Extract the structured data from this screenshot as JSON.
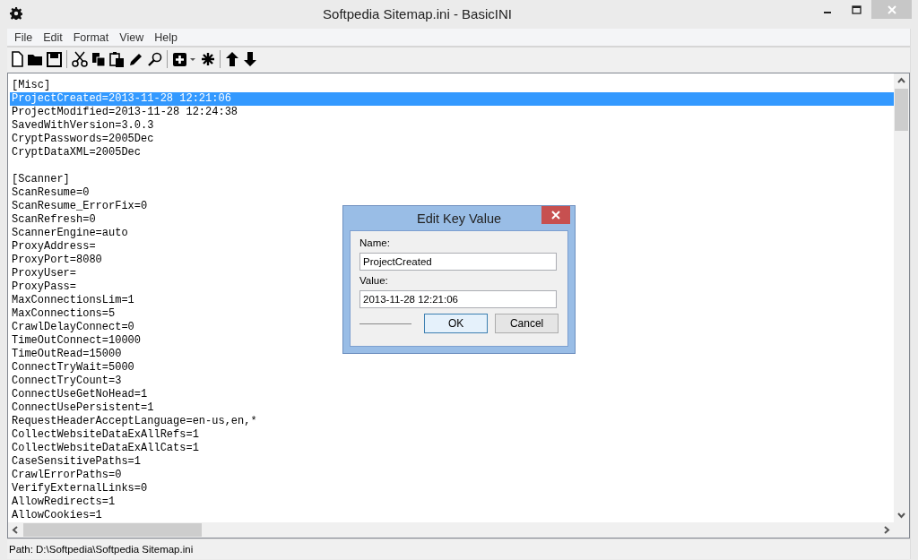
{
  "window": {
    "title": "Softpedia Sitemap.ini - BasicINI"
  },
  "menu": [
    "File",
    "Edit",
    "Format",
    "View",
    "Help"
  ],
  "sections": [
    {
      "lines": [
        {
          "text": "[Misc]",
          "selected": false
        },
        {
          "text": "ProjectCreated=2013-11-28 12:21:06",
          "selected": true
        },
        {
          "text": "ProjectModified=2013-11-28 12:24:38",
          "selected": false
        },
        {
          "text": "SavedWithVersion=3.0.3",
          "selected": false
        },
        {
          "text": "CryptPasswords=2005Dec",
          "selected": false
        },
        {
          "text": "CryptDataXML=2005Dec",
          "selected": false
        }
      ]
    },
    {
      "lines": [
        {
          "text": "[Scanner]",
          "selected": false
        },
        {
          "text": "ScanResume=0",
          "selected": false
        },
        {
          "text": "ScanResume_ErrorFix=0",
          "selected": false
        },
        {
          "text": "ScanRefresh=0",
          "selected": false
        },
        {
          "text": "ScannerEngine=auto",
          "selected": false
        },
        {
          "text": "ProxyAddress=",
          "selected": false
        },
        {
          "text": "ProxyPort=8080",
          "selected": false
        },
        {
          "text": "ProxyUser=",
          "selected": false
        },
        {
          "text": "ProxyPass=",
          "selected": false
        },
        {
          "text": "MaxConnectionsLim=1",
          "selected": false
        },
        {
          "text": "MaxConnections=5",
          "selected": false
        },
        {
          "text": "CrawlDelayConnect=0",
          "selected": false
        },
        {
          "text": "TimeOutConnect=10000",
          "selected": false
        },
        {
          "text": "TimeOutRead=15000",
          "selected": false
        },
        {
          "text": "ConnectTryWait=5000",
          "selected": false
        },
        {
          "text": "ConnectTryCount=3",
          "selected": false
        },
        {
          "text": "ConnectUseGetNoHead=1",
          "selected": false
        },
        {
          "text": "ConnectUsePersistent=1",
          "selected": false
        },
        {
          "text": "RequestHeaderAcceptLanguage=en-us,en,*",
          "selected": false
        },
        {
          "text": "CollectWebsiteDataExAllRefs=1",
          "selected": false
        },
        {
          "text": "CollectWebsiteDataExAllCats=1",
          "selected": false
        },
        {
          "text": "CaseSensitivePaths=1",
          "selected": false
        },
        {
          "text": "CrawlErrorPaths=0",
          "selected": false
        },
        {
          "text": "VerifyExternalLinks=0",
          "selected": false
        },
        {
          "text": "AllowRedirects=1",
          "selected": false
        },
        {
          "text": "AllowCookies=1",
          "selected": false
        }
      ]
    }
  ],
  "dialog": {
    "title": "Edit Key Value",
    "name_label": "Name:",
    "name_value": "ProjectCreated",
    "value_label": "Value:",
    "value_value": "2013-11-28 12:21:06",
    "buttons": [
      {
        "label": "OK",
        "default": true
      },
      {
        "label": "Cancel",
        "default": false
      }
    ]
  },
  "status_bar": {
    "path": "Path:  D:\\Softpedia\\Softpedia Sitemap.ini"
  }
}
